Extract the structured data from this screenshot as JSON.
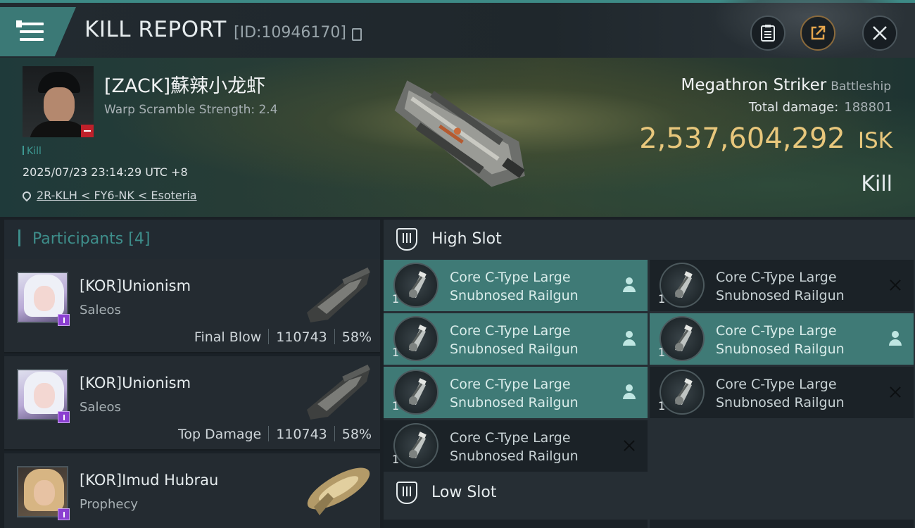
{
  "header": {
    "title": "KILL REPORT",
    "report_id": "[ID:10946170]"
  },
  "victim": {
    "pilot_name": "[ZACK]蘇辣小龙虾",
    "warp_scramble": "Warp Scramble Strength: 2.4",
    "kill_tag": "Kill",
    "datetime": "2025/07/23 23:14:29 UTC +8",
    "location": "2R-KLH < FY6-NK < Esoteria",
    "ship_name": "Megathron Striker",
    "ship_class": "Battleship",
    "total_damage_label": "Total damage:",
    "total_damage": "188801",
    "isk_value": "2,537,604,292",
    "isk_unit": "ISK",
    "result": "Kill"
  },
  "participants": {
    "title": "Participants",
    "count": "[4]",
    "rows": [
      {
        "name": "[KOR]Unionism",
        "ship": "Saleos",
        "role": "Final Blow",
        "damage": "110743",
        "percent": "58%"
      },
      {
        "name": "[KOR]Unionism",
        "ship": "Saleos",
        "role": "Top Damage",
        "damage": "110743",
        "percent": "58%"
      },
      {
        "name": "[KOR]Imud Hubrau",
        "ship": "Prophecy"
      }
    ]
  },
  "fitting": {
    "high_slot_label": "High Slot",
    "low_slot_label": "Low Slot",
    "high_slots": [
      {
        "qty": "1",
        "line1": "Core C-Type Large",
        "line2": "Snubnosed Railgun",
        "state": "dropped",
        "icon": "person-icon"
      },
      {
        "qty": "1",
        "line1": "Core C-Type Large",
        "line2": "Snubnosed Railgun",
        "state": "destroyed",
        "icon": "x-icon"
      },
      {
        "qty": "1",
        "line1": "Core C-Type Large",
        "line2": "Snubnosed Railgun",
        "state": "dropped",
        "icon": "person-icon"
      },
      {
        "qty": "1",
        "line1": "Core C-Type Large",
        "line2": "Snubnosed Railgun",
        "state": "dropped",
        "icon": "person-icon"
      },
      {
        "qty": "1",
        "line1": "Core C-Type Large",
        "line2": "Snubnosed Railgun",
        "state": "dropped",
        "icon": "person-icon"
      },
      {
        "qty": "1",
        "line1": "Core C-Type Large",
        "line2": "Snubnosed Railgun",
        "state": "destroyed",
        "icon": "x-icon"
      },
      {
        "qty": "1",
        "line1": "Core C-Type Large",
        "line2": "Snubnosed Railgun",
        "state": "destroyed",
        "icon": "x-icon"
      }
    ]
  },
  "colors": {
    "accent": "#3e8e8b",
    "isk_gold": "#e8c77c",
    "dropped_slot": "#3f7a76",
    "destroyed_slot": "#1b2227"
  }
}
